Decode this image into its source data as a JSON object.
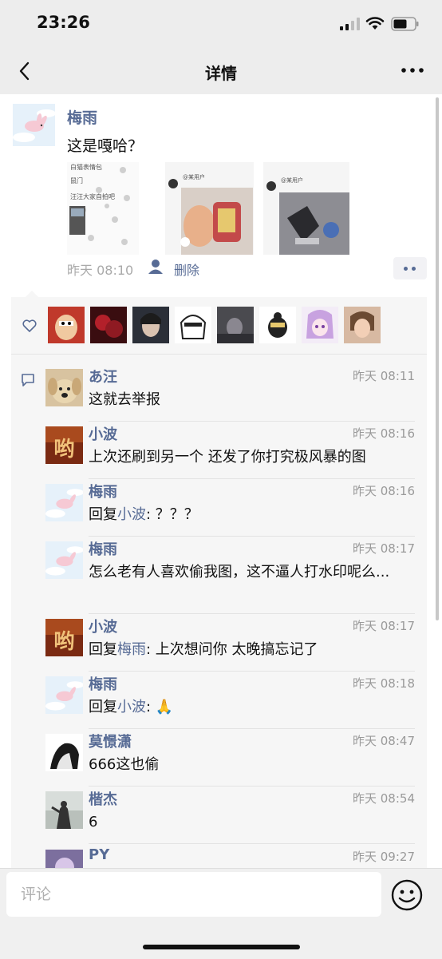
{
  "status_bar": {
    "time": "23:26"
  },
  "nav": {
    "title": "详情",
    "back_icon": "chevron-left-icon",
    "more_icon": "ellipsis-icon"
  },
  "post": {
    "author": "梅雨",
    "text": "这是嘎哈？",
    "time": "昨天 08:10",
    "delete_label": "删除",
    "images": [
      {
        "desc_lines": [
          "白猫表情包",
          "鼠门",
          "汪汪大家自拍吧"
        ]
      },
      {
        "desc_lines": [
          "@某用户"
        ]
      },
      {
        "desc_lines": [
          "@某用户"
        ]
      }
    ]
  },
  "likes": {
    "count": 8
  },
  "comments": [
    {
      "name": "あ汪",
      "time": "昨天 08:11",
      "text": "这就去举报",
      "avatar_color": "#cfb38a"
    },
    {
      "name": "小波",
      "time": "昨天 08:16",
      "text": "上次还刷到另一个 还发了你打究极风暴的图",
      "avatar_color": "#8a3a1e"
    },
    {
      "name": "梅雨",
      "time": "昨天 08:16",
      "reply_prefix": "回复",
      "reply_to": "小波",
      "text": ": ？？？",
      "avatar_color": "#e9f3fb"
    },
    {
      "name": "梅雨",
      "time": "昨天 08:17",
      "text": "怎么老有人喜欢偷我图，这不逼人打水印呢么...",
      "avatar_color": "#e9f3fb"
    },
    {
      "name": "小波",
      "time": "昨天 08:17",
      "reply_prefix": "回复",
      "reply_to": "梅雨",
      "text": ": 上次想问你 太晚搞忘记了",
      "avatar_color": "#8a3a1e"
    },
    {
      "name": "梅雨",
      "time": "昨天 08:18",
      "reply_prefix": "回复",
      "reply_to": "小波",
      "text": ": 🙏",
      "avatar_color": "#e9f3fb"
    },
    {
      "name": "莫憬潇",
      "time": "昨天 08:47",
      "text": "666这也偷",
      "avatar_color": "#222222"
    },
    {
      "name": "楷杰",
      "time": "昨天 08:54",
      "text": "6",
      "avatar_color": "#9aa39a"
    },
    {
      "name": "PY",
      "time": "昨天 09:27",
      "text": "",
      "avatar_color": "#7c6f9e"
    }
  ],
  "input": {
    "placeholder": "评论",
    "emoji_icon": "smiley-icon"
  }
}
